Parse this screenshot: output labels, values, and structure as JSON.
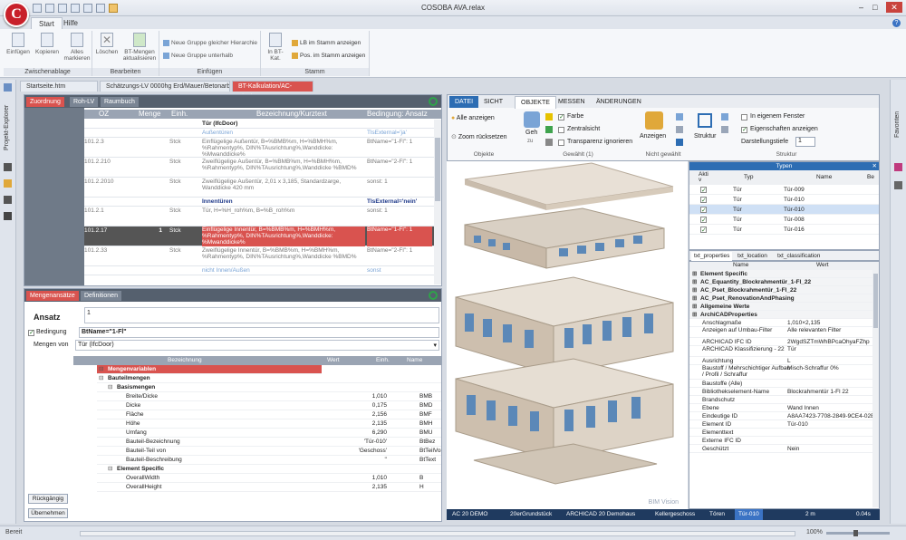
{
  "app": {
    "title": "COSOBA AVA.relax",
    "logo_letter": "C",
    "ribbon_tabs": [
      "Start",
      "Hilfe"
    ]
  },
  "ribbon": {
    "groups": [
      {
        "label": "Zwischenablage",
        "buttons": [
          "Einfügen",
          "Kopieren",
          "Alles markieren"
        ]
      },
      {
        "label": "Bearbeiten",
        "buttons": [
          "Löschen",
          "BT-Mengen aktualisieren"
        ]
      },
      {
        "label": "Einfügen",
        "buttons": [
          "Neue Gruppe gleicher Hierarchie",
          "Neue Gruppe unterhalb"
        ]
      },
      {
        "label": "Stamm",
        "buttons": [
          "In BT-Kat.",
          "LB im Stamm anzeigen",
          "Pos. im Stamm anzeigen"
        ]
      }
    ]
  },
  "doc_tabs": [
    "Startseite.htm",
    "Schätzungs-LV 0000hg Erd/Mauer/Betonarbeiten",
    "BT-Kalkulation/AC-Final*"
  ],
  "left_sidebar": {
    "label": "Projekt-Explorer"
  },
  "right_sidebar": {
    "label": "Favoriten"
  },
  "top_panel": {
    "tabs": [
      "Zuordnung",
      "Roh-LV",
      "Raumbuch"
    ],
    "columns": [
      "OZ",
      "Menge",
      "Einh.",
      "Bezeichnung/Kurztext",
      "Bedingung: Ansatz"
    ],
    "rows": [
      {
        "oz": "",
        "menge": "",
        "einh": "",
        "text": "Tür (IfcDoor)",
        "cond": "",
        "type": "group"
      },
      {
        "oz": "",
        "menge": "",
        "einh": "",
        "text": "Außentüren",
        "cond": "TlsExternal='ja'",
        "type": "sub"
      },
      {
        "oz": "101.2.3",
        "menge": "",
        "einh": "Stck",
        "text": "Einflügelige Außentür, B=%BMB%m, H=%BMH%m, %Rahmentyp%, DIN%TAusrichtung%,Wanddicke: %Mwanddicke%",
        "cond": "BtName=\"1-Fl\": 1"
      },
      {
        "oz": "101.2.210",
        "menge": "",
        "einh": "Stck",
        "text": "Zweiflügelige Außentür, B=%BMB%m, H=%BMH%m, %Rahmentyp%, DIN%TAusrichtung%,Wanddicke %BMD%",
        "cond": "BtName=\"2-Fl\": 1"
      },
      {
        "oz": "101.2.2010",
        "menge": "",
        "einh": "Stck",
        "text": "Zweiflügelige Außentür, 2,01 x 3,185, Standardzarge, Wanddicke 420 mm",
        "cond": "sonst: 1"
      },
      {
        "oz": "",
        "menge": "",
        "einh": "",
        "text": "Innentüren",
        "cond": "TlsExternal='nein'",
        "type": "sub2"
      },
      {
        "oz": "101.2.1",
        "menge": "",
        "einh": "Stck",
        "text": "Tür, H=%H_roh%m, B=%B_roh%m",
        "cond": "sonst: 1"
      },
      {
        "oz": "101.2.17",
        "menge": "1",
        "einh": "Stck",
        "text": "Einflügelige Innentür, B=%BMB%m, H=%BMH%m, %Rahmentyp%, DIN%TAusrichtung%,Wanddicke: %Mwanddicke%",
        "cond": "BtName=\"1-Fl\": 1",
        "type": "sel"
      },
      {
        "oz": "101.2.33",
        "menge": "",
        "einh": "Stck",
        "text": "Zweiflügelige Innentür, B=%BMB%m, H=%BMH%m, %Rahmentyp%, DIN%TAusrichtung%,Wanddicke %BMD%",
        "cond": "BtName=\"2-Fl\": 1"
      },
      {
        "oz": "",
        "menge": "",
        "einh": "",
        "text": "nicht Innen/Außen",
        "cond": "sonst",
        "type": "sub"
      }
    ]
  },
  "bottom_panel": {
    "tabs": [
      "Mengenansätze",
      "Definitionen"
    ],
    "ansatz_label": "Ansatz",
    "ansatz_value": "1",
    "bedingung_label": "Bedingung",
    "bedingung_value": "BtName=\"1-Fl\"",
    "mengen_von_label": "Mengen von",
    "mengen_von_value": "Tür (IfcDoor)",
    "columns": [
      "Bezeichnung",
      "Wert",
      "Einh.",
      "Name"
    ],
    "rows": [
      {
        "name": "Mengenvariablen",
        "wert": "",
        "einh": "",
        "var": "",
        "level": 0,
        "type": "red"
      },
      {
        "name": "Bauteilmengen",
        "wert": "",
        "einh": "",
        "var": "",
        "level": 0,
        "type": "bold"
      },
      {
        "name": "Basismengen",
        "wert": "",
        "einh": "",
        "var": "",
        "level": 1,
        "type": "bold"
      },
      {
        "name": "Breite/Dicke",
        "wert": "1,010",
        "einh": "",
        "var": "BMB",
        "level": 2
      },
      {
        "name": "Dicke",
        "wert": "0,175",
        "einh": "",
        "var": "BMD",
        "level": 2
      },
      {
        "name": "Fläche",
        "wert": "2,156",
        "einh": "",
        "var": "BMF",
        "level": 2
      },
      {
        "name": "Höhe",
        "wert": "2,135",
        "einh": "",
        "var": "BMH",
        "level": 2
      },
      {
        "name": "Umfang",
        "wert": "6,290",
        "einh": "",
        "var": "BMU",
        "level": 2
      },
      {
        "name": "Bauteil-Bezeichnung",
        "wert": "'Tür-010'",
        "einh": "",
        "var": "BtBez",
        "level": 2
      },
      {
        "name": "Bauteil-Teil von",
        "wert": "'Geschoss'",
        "einh": "",
        "var": "BtTeilVon",
        "level": 2
      },
      {
        "name": "Bauteil-Beschreibung",
        "wert": "''",
        "einh": "",
        "var": "BtText",
        "level": 2
      },
      {
        "name": "Element Specific",
        "wert": "",
        "einh": "",
        "var": "",
        "level": 1,
        "type": "bold"
      },
      {
        "name": "OverallWidth",
        "wert": "1,010",
        "einh": "",
        "var": "B",
        "level": 2
      },
      {
        "name": "OverallHeight",
        "wert": "2,135",
        "einh": "",
        "var": "H",
        "level": 2
      }
    ],
    "btn_rueckgaengig": "Rückgängig",
    "btn_uebernehmen": "Übernehmen"
  },
  "bim": {
    "tabs": [
      "DATEI",
      "SICHT",
      "OBJEKTE",
      "MESSEN",
      "ÄNDERUNGEN"
    ],
    "active_tab": "OBJEKTE",
    "objekte_group": {
      "label": "Objekte",
      "items": [
        "Alle anzeigen",
        "Zoom rücksetzen"
      ]
    },
    "gewaehlt_group": {
      "label": "Gewählt (1)",
      "geh_label": "Geh",
      "geh_sub": "zu",
      "checks": [
        {
          "label": "Farbe",
          "on": true
        },
        {
          "label": "Zentralsicht",
          "on": false
        },
        {
          "label": "Transparenz ignorieren",
          "on": false
        }
      ]
    },
    "nicht_group": {
      "label": "Nicht gewählt",
      "anzeigen": "Anzeigen"
    },
    "struktur_group": {
      "label": "Struktur",
      "struktur_btn": "Struktur",
      "checks": [
        {
          "label": "In eigenem Fenster",
          "on": false
        },
        {
          "label": "Eigenschaften anzeigen",
          "on": true
        }
      ],
      "tiefe_label": "Darstellungstiefe",
      "tiefe_value": "1"
    },
    "watermark": "BIM Vision",
    "types_panel": {
      "title": "Typen",
      "columns": [
        "Akti v",
        "Typ",
        "Name",
        "Be"
      ],
      "rows": [
        {
          "typ": "Tür",
          "name": "Tür-009"
        },
        {
          "typ": "Tür",
          "name": "Tür-010"
        },
        {
          "typ": "Tür",
          "name": "Tür-010",
          "sel": true
        },
        {
          "typ": "Tür",
          "name": "Tür-008"
        },
        {
          "typ": "Tür",
          "name": "Tür-016"
        }
      ]
    },
    "props_tabs": [
      "txt_properties",
      "txt_location",
      "txt_classification"
    ],
    "props_columns": [
      "Name",
      "Wert"
    ],
    "props": [
      {
        "name": "Element Specific",
        "value": "",
        "bold": true
      },
      {
        "name": "AC_Equantity_Blockrahmentür_1-Fl_22",
        "value": "",
        "bold": true
      },
      {
        "name": "AC_Pset_Blockrahmentür_1-Fl_22",
        "value": "",
        "bold": true
      },
      {
        "name": "AC_Pset_RenovationAndPhasing",
        "value": "",
        "bold": true
      },
      {
        "name": "Allgemeine Werte",
        "value": "",
        "bold": true
      },
      {
        "name": "ArchiCADProperties",
        "value": "",
        "bold": true
      },
      {
        "name": "Anschlagmaße",
        "value": "1,010×2,135"
      },
      {
        "name": "Anzeigen auf Umbau-Filter",
        "value": "Alle relevanten Filter"
      },
      {
        "name": "ARCHICAD IFC ID",
        "value": "2WgdSZTmWhBPcaOhyaFZhp"
      },
      {
        "name": "ARCHICAD Klassifizierung - 22",
        "value": "Tür"
      },
      {
        "name": "Ausrichtung",
        "value": "L"
      },
      {
        "name": "Baustoff / Mehrschichtiger Aufbau / Profil / Schraffur",
        "value": "Misch-Schraffur 0%"
      },
      {
        "name": "Baustoffe (Alle)",
        "value": ""
      },
      {
        "name": "Bibliothekselement-Name",
        "value": "Blockrahmentür 1-Fl 22"
      },
      {
        "name": "Brandschutz",
        "value": ""
      },
      {
        "name": "Ebene",
        "value": "Wand Innen"
      },
      {
        "name": "Eindeutige ID",
        "value": "A8AA7423-7708-2849-9CE4-02BF243E3AF3"
      },
      {
        "name": "Element ID",
        "value": "Tür-010"
      },
      {
        "name": "Elementtext",
        "value": ""
      },
      {
        "name": "Externe IFC ID",
        "value": ""
      },
      {
        "name": "Geschützt",
        "value": "Nein"
      }
    ],
    "statusbar": [
      "AC 20 DEMO",
      "20erGrundstück",
      "ARCHICAD 20 Demohaus",
      "Kellergeschoss",
      "Tören",
      "Tür-010",
      "2 m",
      "0.04s"
    ]
  },
  "statusbar": {
    "left": "Bereit",
    "zoom": "100%"
  }
}
